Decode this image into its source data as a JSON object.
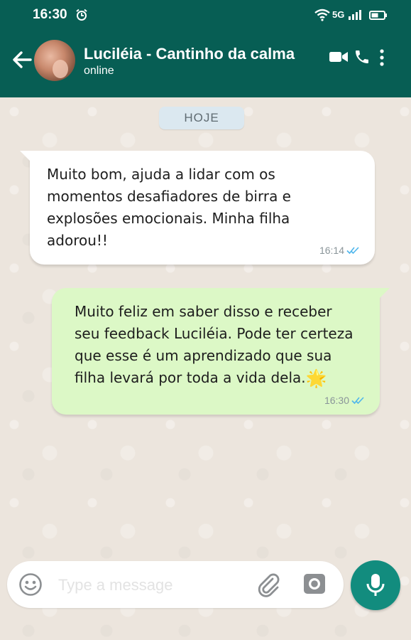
{
  "status_bar": {
    "time": "16:30",
    "network": "5G",
    "icons": [
      "alarm-icon",
      "wifi-icon",
      "signal-icon",
      "battery-icon"
    ]
  },
  "header": {
    "contact_name": "Luciléia - Cantinho da calma",
    "contact_status": "online",
    "icons": [
      "back-arrow-icon",
      "video-call-icon",
      "phone-call-icon",
      "more-vert-icon"
    ],
    "color": "#075e54"
  },
  "chat": {
    "date_separator": "HOJE",
    "messages": [
      {
        "direction": "incoming",
        "text": "Muito bom, ajuda a lidar com os\nmomentos desafiadores de birra e\nexplosões emocionais. Minha filha\nadorou!!",
        "time": "16:14",
        "status": "read"
      },
      {
        "direction": "outgoing",
        "text": "Muito feliz em saber disso e receber\nseu feedback Luciléia. Pode ter certeza\nque esse é um aprendizado que sua\nfilha levará por toda a vida dela.",
        "emoji": "🌟",
        "time": "16:30",
        "status": "read"
      }
    ],
    "colors": {
      "incoming_bubble": "#ffffff",
      "outgoing_bubble": "#dcf8c6",
      "read_ticks": "#4fb6ec"
    }
  },
  "composer": {
    "placeholder": "Type a message",
    "value": "",
    "icons": [
      "emoji-icon",
      "attach-icon",
      "camera-icon",
      "mic-icon"
    ],
    "mic_color": "#128c7e"
  }
}
